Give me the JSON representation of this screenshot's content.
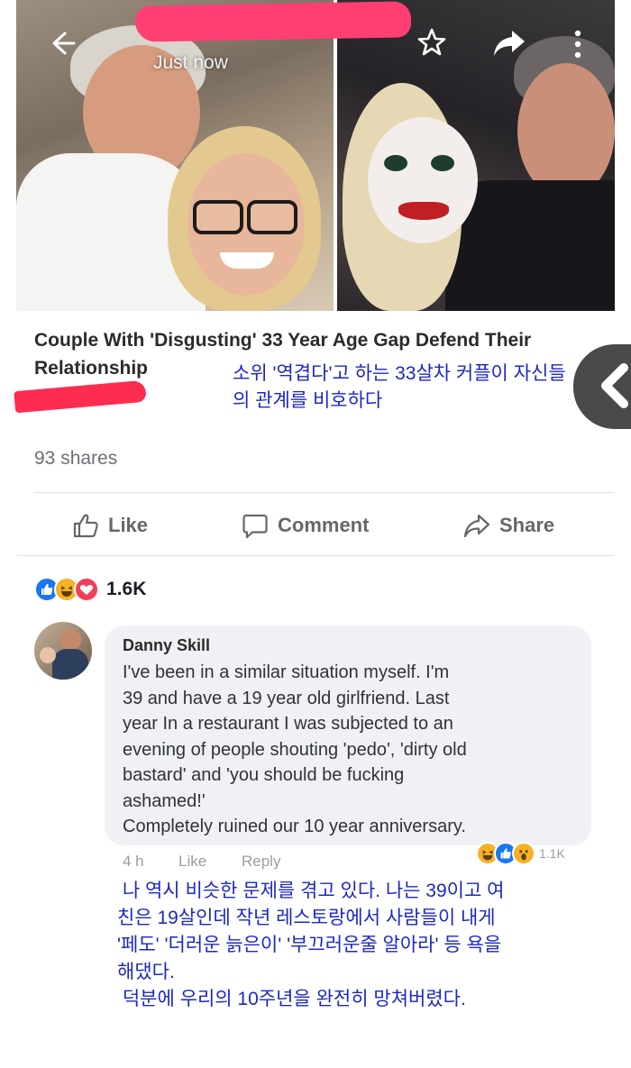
{
  "post": {
    "timestamp": "Just now",
    "article_title": "Couple With 'Disgusting' 33 Year Age Gap Defend Their Relationship",
    "shares": "93 shares"
  },
  "overlay": {
    "title_translation": "소위 '역겹다'고 하는 33살차 커플이 자신들의 관계를 비호하다",
    "comment_translation": [
      " 나 역시 비슷한 문제를 겪고 있다. 나는 39이고 여",
      "친은 19살인데 작년 레스토랑에서 사람들이 내게",
      "'페도' '더러운 늙은이' '부끄러운줄 알아라' 등 욕을",
      "해댔다.",
      " 덕분에 우리의 10주년을 완전히 망쳐버렸다."
    ]
  },
  "actions": {
    "like": "Like",
    "comment": "Comment",
    "share": "Share"
  },
  "reactions": {
    "count": "1.6K",
    "types": [
      "like",
      "haha",
      "love"
    ]
  },
  "comment": {
    "author": "Danny Skill",
    "text": "I've been in a similar situation  myself. I'm 39 and have a 19 year old girlfriend. Last year In a restaurant I was subjected to an evening of people shouting 'pedo', 'dirty old bastard' and 'you should be fucking ashamed!' Completely ruined our 10 year anniversary.",
    "lines": [
      "I've been in a similar situation  myself. I'm",
      "39 and have a 19 year old girlfriend. Last",
      "year In a restaurant I was subjected to an",
      "evening of people shouting 'pedo', 'dirty old",
      "bastard' and 'you should be fucking",
      "ashamed!'",
      "Completely ruined our 10 year anniversary."
    ],
    "time": "4 h",
    "like_label": "Like",
    "reply_label": "Reply",
    "reaction_count": "1.1K",
    "reaction_types": [
      "haha",
      "like",
      "wow"
    ]
  },
  "icons": {
    "back": "arrow-left-icon",
    "bookmark": "star-icon",
    "share_top": "share-arrow-icon",
    "more": "more-vertical-icon",
    "side_back": "chevron-left-icon"
  },
  "colors": {
    "facebook_blue": "#1877f2",
    "text_blue": "#1d27c4",
    "redaction_pink": "#ff3f73",
    "love_red": "#f33e58",
    "haha_yellow": "#f7b125"
  }
}
